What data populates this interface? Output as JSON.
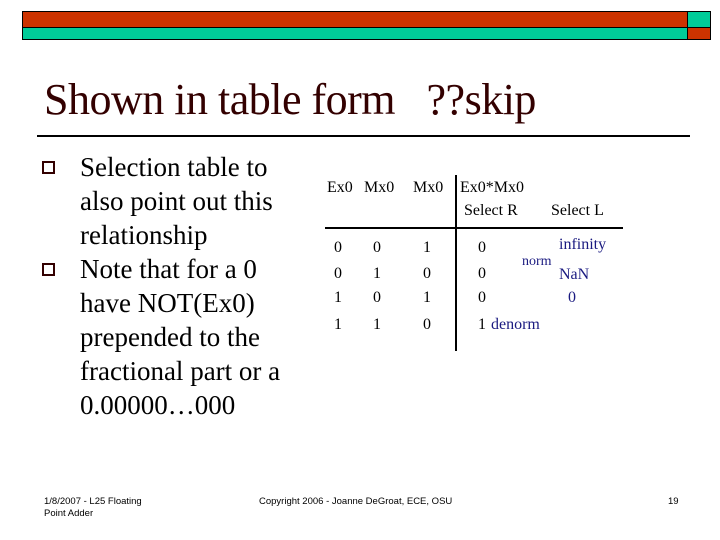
{
  "slide": {
    "title": "Shown in table form   ??skip",
    "bullets": [
      "Selection table to also point out this relationship",
      "Note that for a 0 have NOT(Ex0) prepended to the fractional part or a 0.00000…000"
    ],
    "colors": {
      "header_red": "#cc3300",
      "header_teal": "#00cc99",
      "title": "#330000",
      "table_annotation": "#1a1a80"
    }
  },
  "table": {
    "headers": {
      "col1": "Ex0",
      "col2": "Mx0",
      "col3": "Mx0",
      "col4": "Ex0*Mx0",
      "select_r": "Select R",
      "select_l": "Select L"
    },
    "rows": [
      {
        "ex0": "0",
        "mx0_a": "0",
        "mx0_b": "1",
        "product": "0",
        "annotation": "infinity"
      },
      {
        "ex0": "0",
        "mx0_a": "1",
        "mx0_b": "0",
        "product": "0",
        "annotation_r": "norm",
        "annotation": "NaN"
      },
      {
        "ex0": "1",
        "mx0_a": "0",
        "mx0_b": "1",
        "product": "0",
        "annotation": "0"
      },
      {
        "ex0": "1",
        "mx0_a": "1",
        "mx0_b": "0",
        "product": "1",
        "annotation_r": "denorm"
      }
    ]
  },
  "footer": {
    "left_line1": "1/8/2007 - L25 Floating",
    "left_line2": "Point Adder",
    "center": "Copyright 2006 - Joanne DeGroat, ECE, OSU",
    "page_number": "19"
  }
}
